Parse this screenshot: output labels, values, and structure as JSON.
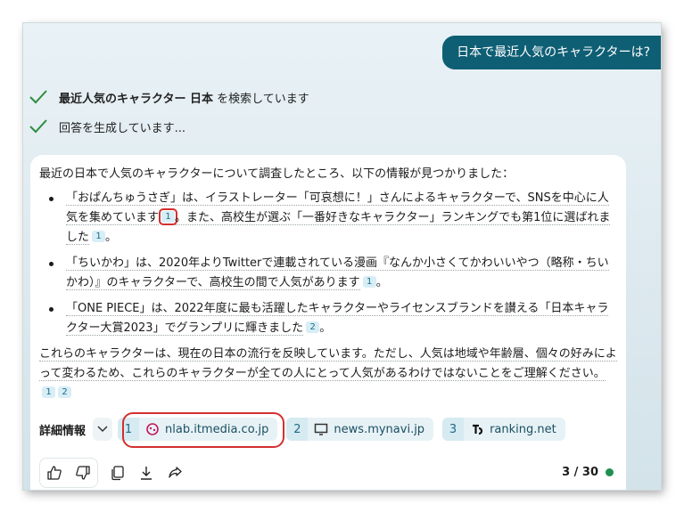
{
  "user_message": "日本で最近人気のキャラクターは?",
  "steps": [
    {
      "pre": "",
      "bold": "最近人気のキャラクター 日本",
      "post": " を検索しています"
    },
    {
      "pre": "回答を生成しています...",
      "bold": "",
      "post": ""
    }
  ],
  "answer": {
    "intro": "最近の日本で人気のキャラクターについて調査したところ、以下の情報が見つかりました：",
    "bullets": [
      {
        "text_a": "「おぱんちゅうさぎ」は、イラストレーター「可哀想に！」さんによるキャラクターで、SNSを中心に人気を集めています",
        "cite_a": "1",
        "text_b": "。また、高校生が選ぶ「一番好きなキャラクター」ランキングでも第1位に選ばれました",
        "cite_b": "1",
        "tail": "。"
      },
      {
        "text_a": "「ちいかわ」は、2020年よりTwitterで連載されている漫画『なんか小さくてかわいいやつ（略称・ちいかわ）』のキャラクターで、高校生の間で人気があります",
        "cite_a": "1",
        "tail": "。"
      },
      {
        "text_a": "「ONE PIECE」は、2022年度に最も活躍したキャラクターやライセンスブランドを讃える「日本キャラクター大賞2023」でグランプリに輝きました",
        "cite_a": "2",
        "tail": "。"
      }
    ],
    "closing": "これらのキャラクターは、現在の日本の流行を反映しています。ただし、人気は地域や年齢層、個々の好みによって変わるため、これらのキャラクターが全ての人にとって人気があるわけではないことをご理解ください。",
    "closing_cites": [
      "1",
      "2"
    ]
  },
  "details": {
    "label": "詳細情報",
    "sources": [
      {
        "num": "1",
        "domain": "nlab.itmedia.co.jp",
        "icon": "itmedia-favicon"
      },
      {
        "num": "2",
        "domain": "news.mynavi.jp",
        "icon": "monitor-icon"
      },
      {
        "num": "3",
        "domain": "ranking.net",
        "icon": "ranking-logo-icon"
      }
    ]
  },
  "counter": "3 / 30",
  "colors": {
    "accent": "#0f5f74",
    "highlight": "#d32f2f",
    "status": "#1f8f4e"
  }
}
